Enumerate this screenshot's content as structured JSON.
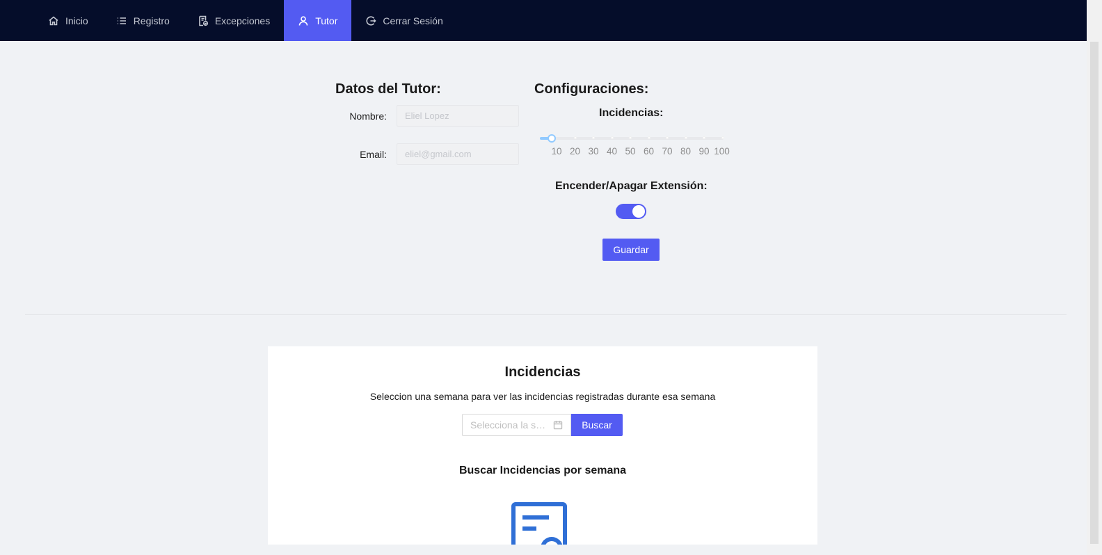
{
  "nav": {
    "items": [
      {
        "label": "Inicio",
        "icon": "home-icon"
      },
      {
        "label": "Registro",
        "icon": "list-icon"
      },
      {
        "label": "Excepciones",
        "icon": "document-check-icon"
      },
      {
        "label": "Tutor",
        "icon": "user-icon",
        "active": true
      },
      {
        "label": "Cerrar Sesión",
        "icon": "logout-icon"
      }
    ]
  },
  "tutor": {
    "title": "Datos del Tutor:",
    "name_label": "Nombre",
    "name_value": "Eliel Lopez",
    "email_label": "Email",
    "email_value": "eliel@gmail.com"
  },
  "config": {
    "title": "Configuraciones:",
    "incidencias_label": "Incidencias:",
    "slider": {
      "value": 10,
      "marks": [
        "10",
        "20",
        "30",
        "40",
        "50",
        "60",
        "70",
        "80",
        "90",
        "100"
      ]
    },
    "extension_label": "Encender/Apagar Extensión:",
    "extension_on": true,
    "save_label": "Guardar"
  },
  "incidencias_card": {
    "title": "Incidencias",
    "description": "Seleccion una semana para ver las incidencias registradas durante esa semana",
    "week_placeholder": "Selecciona la semana",
    "search_label": "Buscar",
    "subtitle": "Buscar Incidencias por semana"
  },
  "colors": {
    "nav_bg": "#050d2a",
    "accent": "#535bf2",
    "page_bg": "#f0f2f5",
    "illustration": "#2f6fd6"
  }
}
